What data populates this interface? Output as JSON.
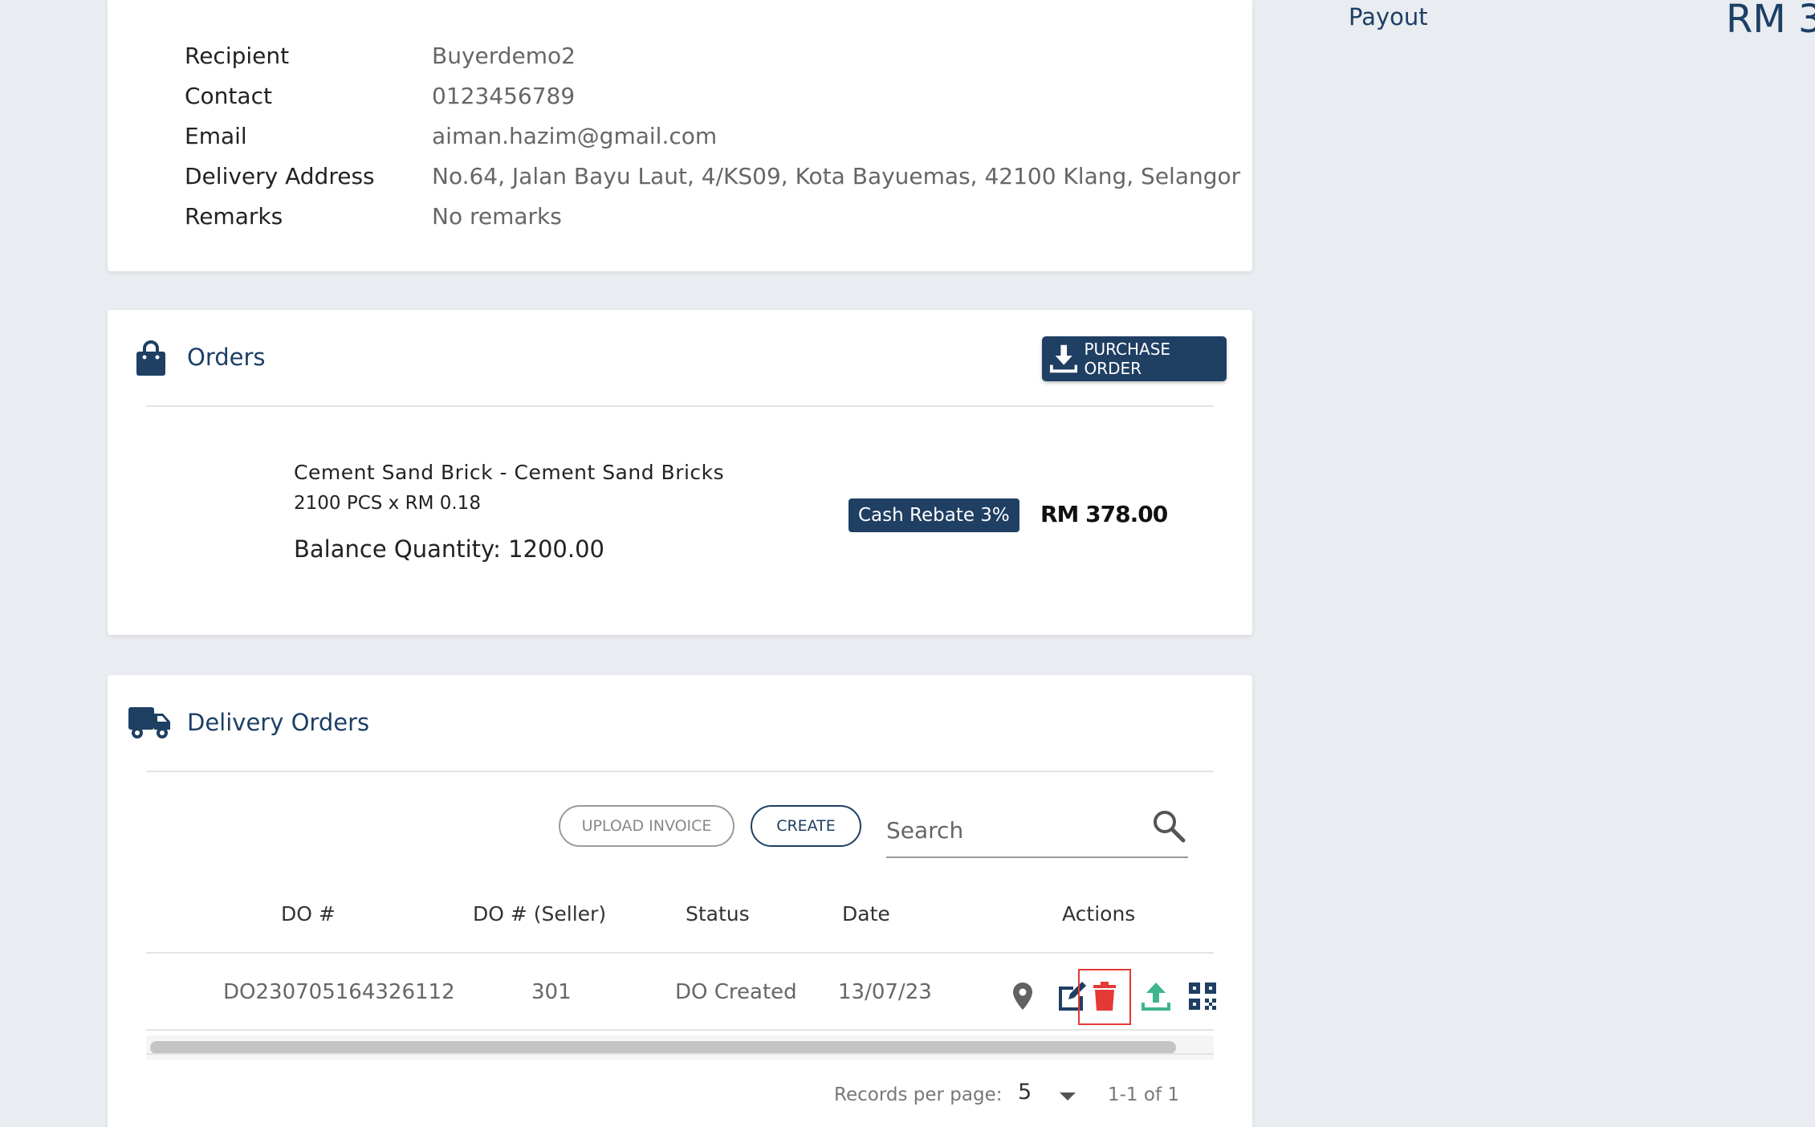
{
  "recipient_info": {
    "rows": [
      {
        "label": "Recipient",
        "value": "Buyerdemo2"
      },
      {
        "label": "Contact",
        "value": "0123456789"
      },
      {
        "label": "Email",
        "value": "aiman.hazim@gmail.com"
      },
      {
        "label": "Delivery Address",
        "value": "No.64, Jalan Bayu Laut, 4/KS09, Kota Bayuemas, 42100 Klang, Selangor"
      },
      {
        "label": "Remarks",
        "value": "No remarks"
      }
    ]
  },
  "orders": {
    "title": "Orders",
    "icon": "shopping-bag-icon",
    "purchase_order_label": "PURCHASE ORDER",
    "item": {
      "name": "Cement Sand Brick - Cement Sand Bricks",
      "quantity_line": "2100 PCS x RM 0.18",
      "balance": "Balance Quantity: 1200.00",
      "rebate": "Cash Rebate 3%",
      "price": "RM 378.00"
    }
  },
  "delivery_orders": {
    "title": "Delivery Orders",
    "icon": "truck-icon",
    "upload_invoice_label": "UPLOAD INVOICE",
    "create_label": "CREATE",
    "search_placeholder": "Search",
    "columns": [
      "DO #",
      "DO # (Seller)",
      "Status",
      "Date",
      "Actions"
    ],
    "rows": [
      {
        "do_number": "DO230705164326112",
        "do_seller": "301",
        "status": "DO Created",
        "date": "13/07/23"
      }
    ],
    "actions": [
      "map-pin-icon",
      "edit-icon",
      "trash-icon",
      "upload-icon",
      "qr-code-icon"
    ],
    "records_per_page_label": "Records per page:",
    "records_per_page": "5",
    "page_range": "1-1 of 1"
  },
  "sidebar": {
    "payout_label": "Payout",
    "payout_amount": "RM 3"
  },
  "colors": {
    "primary": "#1f3f63",
    "danger": "#e53935",
    "success": "#3fb58c"
  }
}
